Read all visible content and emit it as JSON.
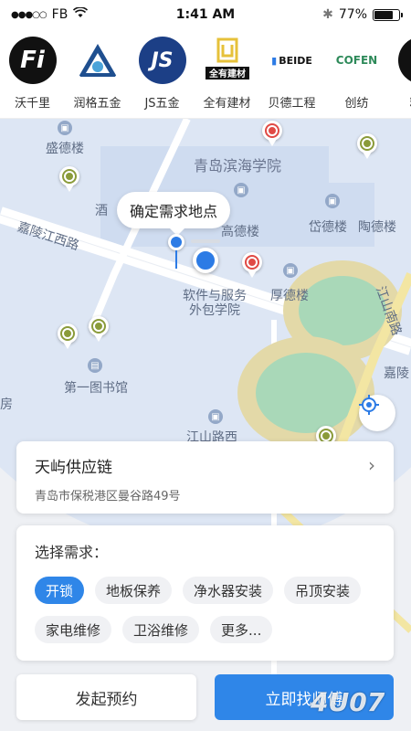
{
  "status": {
    "carrier": "FB",
    "time": "1:41 AM",
    "battery_text": "77%",
    "battery_level": 0.77
  },
  "brands": [
    {
      "name": "沃千里",
      "logo_text": "Fi",
      "color": "#111111"
    },
    {
      "name": "润格五金",
      "logo_text": "RG",
      "color": "#1f4f8f"
    },
    {
      "name": "JS五金",
      "logo_text": "JS",
      "color": "#1c3f86"
    },
    {
      "name": "全有建材",
      "logo_text": "全有建材",
      "color": "#e6c13a"
    },
    {
      "name": "贝德工程",
      "logo_text": "BEIDE",
      "color": "#ffffff"
    },
    {
      "name": "创纺",
      "logo_text": "COFEN",
      "color": "#ffffff"
    },
    {
      "name": "精鹰",
      "logo_text": "",
      "color": "#111111"
    }
  ],
  "map": {
    "tooltip": "确定需求地点",
    "labels": {
      "l1": "盛德楼",
      "l2": "青岛滨海学院",
      "l3": "嘉陵江西路",
      "l4": "高德楼",
      "l5": "岱德楼",
      "l6": "陶德楼",
      "l7": "软件与服务",
      "l8": "外包学院",
      "l9": "厚德楼",
      "l10": "江山南路",
      "l11": "嘉陵",
      "l12": "第一图书馆",
      "l13": "江山路西",
      "l14": "房",
      "l15": "酒"
    }
  },
  "address": {
    "name": "天屿供应链",
    "detail": "青岛市保税港区曼谷路49号"
  },
  "needs": {
    "title": "选择需求：",
    "options": [
      "开锁",
      "地板保养",
      "净水器安装",
      "吊顶安装",
      "家电维修",
      "卫浴维修",
      "更多..."
    ]
  },
  "buttons": {
    "book": "发起预约",
    "find": "立即找师傅"
  },
  "watermark": "4U07"
}
